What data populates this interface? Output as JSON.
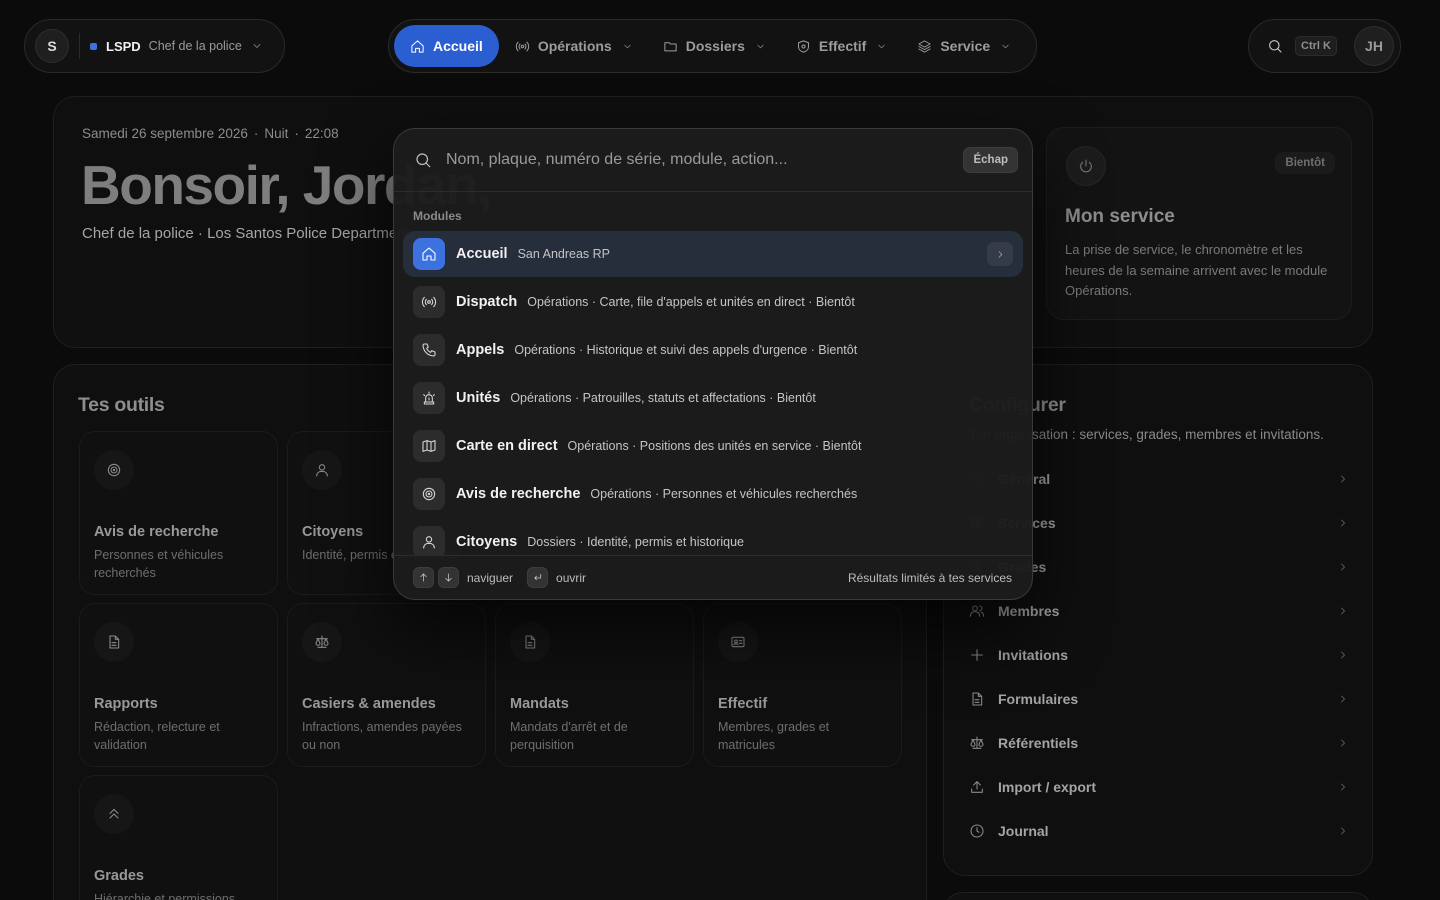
{
  "topbar": {
    "avatar_initial": "S",
    "org": "LSPD",
    "role": "Chef de la police",
    "nav": [
      {
        "label": "Accueil",
        "icon": "home-icon",
        "active": true
      },
      {
        "label": "Opérations",
        "icon": "broadcast-icon"
      },
      {
        "label": "Dossiers",
        "icon": "folder-icon"
      },
      {
        "label": "Effectif",
        "icon": "shield-icon"
      },
      {
        "label": "Service",
        "icon": "layers-icon"
      }
    ],
    "search_shortcut": "Ctrl K",
    "user_initials": "JH"
  },
  "hero": {
    "date": "Samedi 26 septembre 2026",
    "period": "Nuit",
    "time": "22:08",
    "greeting": "Bonsoir, Jordan,",
    "subtitle": "Chef de la police · Los Santos Police Department"
  },
  "service_card": {
    "badge": "Bientôt",
    "title": "Mon service",
    "description": "La prise de service, le chronomètre et les heures de la semaine arrivent avec le module Opérations."
  },
  "tools": {
    "title": "Tes outils",
    "items": [
      {
        "name": "Avis de recherche",
        "desc": "Personnes et véhicules recherchés",
        "icon": "target-icon"
      },
      {
        "name": "Citoyens",
        "desc": "Identité, permis et historique",
        "icon": "user-icon"
      },
      {
        "name": "Rapports",
        "desc": "Rédaction, relecture et validation",
        "icon": "document-icon"
      },
      {
        "name": "Casiers & amendes",
        "desc": "Infractions, amendes payées ou non",
        "icon": "scale-icon"
      },
      {
        "name": "Mandats",
        "desc": "Mandats d'arrêt et de perquisition",
        "icon": "document-icon"
      },
      {
        "name": "Effectif",
        "desc": "Membres, grades et matricules",
        "icon": "id-card-icon"
      },
      {
        "name": "Grades",
        "desc": "Hiérarchie et permissions",
        "icon": "chevrons-up-icon"
      }
    ]
  },
  "config": {
    "title": "Configurer",
    "subtitle": "Ton organisation : services, grades, membres et invitations.",
    "items": [
      {
        "label": "Général",
        "icon": "gear-icon"
      },
      {
        "label": "Services",
        "icon": "grid-icon"
      },
      {
        "label": "Grades",
        "icon": "chevrons-up-icon"
      },
      {
        "label": "Membres",
        "icon": "users-icon"
      },
      {
        "label": "Invitations",
        "icon": "plus-icon"
      },
      {
        "label": "Formulaires",
        "icon": "document-icon"
      },
      {
        "label": "Référentiels",
        "icon": "scale-icon"
      },
      {
        "label": "Import / export",
        "icon": "upload-icon"
      },
      {
        "label": "Journal",
        "icon": "clock-icon"
      }
    ]
  },
  "palette": {
    "placeholder": "Nom, plaque, numéro de série, module, action...",
    "escape_label": "Échap",
    "group_label": "Modules",
    "items": [
      {
        "name": "Accueil",
        "desc": "San Andreas RP",
        "icon": "home-icon",
        "selected": true
      },
      {
        "name": "Dispatch",
        "desc": "Opérations · Carte, file d'appels et unités en direct · Bientôt",
        "icon": "broadcast-icon"
      },
      {
        "name": "Appels",
        "desc": "Opérations · Historique et suivi des appels d'urgence · Bientôt",
        "icon": "phone-icon"
      },
      {
        "name": "Unités",
        "desc": "Opérations · Patrouilles, statuts et affectations · Bientôt",
        "icon": "siren-icon"
      },
      {
        "name": "Carte en direct",
        "desc": "Opérations · Positions des unités en service · Bientôt",
        "icon": "map-icon"
      },
      {
        "name": "Avis de recherche",
        "desc": "Opérations · Personnes et véhicules recherchés",
        "icon": "target-icon"
      },
      {
        "name": "Citoyens",
        "desc": "Dossiers · Identité, permis et historique",
        "icon": "user-icon"
      }
    ],
    "footer": {
      "navigate": "naviguer",
      "open": "ouvrir",
      "note": "Résultats limités à tes services"
    }
  },
  "colors": {
    "accent": "#2b5fd1",
    "accent_light": "#3b72e0",
    "background": "#0b0b0b"
  }
}
